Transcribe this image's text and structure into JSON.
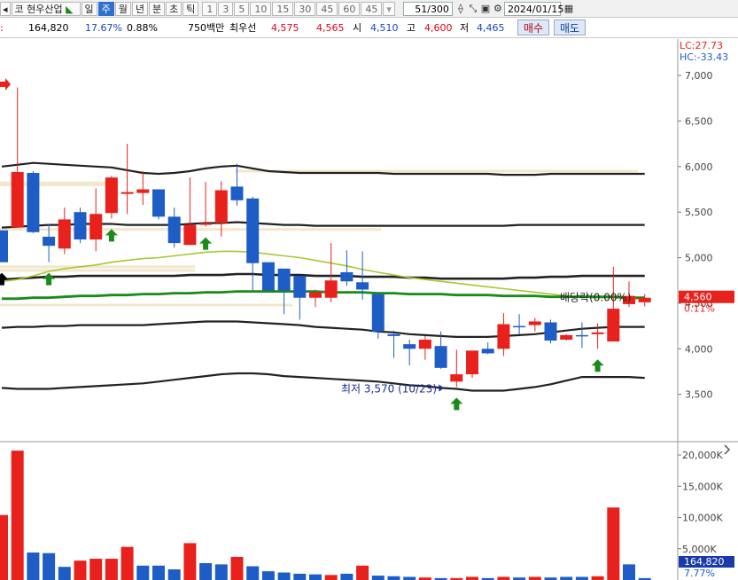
{
  "toolbar": {
    "stock_prefix": "코",
    "stock_name": "현우산업",
    "periods": [
      "일",
      "주",
      "월",
      "년",
      "분",
      "초",
      "틱"
    ],
    "active_period": "주",
    "intervals": [
      "1",
      "3",
      "5",
      "10",
      "15",
      "30",
      "45",
      "60",
      "45"
    ],
    "count_display": "51/300",
    "date": "2024/01/15"
  },
  "quote": {
    "volume": "164,820",
    "turnover_pct": "17.67%",
    "change_pct": "0.88%",
    "trade_amount": "750백만",
    "best_ask_label": "최우선",
    "best_ask": "4,575",
    "best_bid": "4,565",
    "open_label": "시",
    "open": "4,510",
    "high_label": "고",
    "high": "4,600",
    "low_label": "저",
    "low": "4,465",
    "buy_label": "매수",
    "sell_label": "매도"
  },
  "colors": {
    "up": "#e8211c",
    "down": "#1e5dc6",
    "ma_short": "#a8c832",
    "ma_long": "#1a8a1a",
    "band": "#222222",
    "arrow_buy": "#1a8a1a",
    "arrow_special": "#000000"
  },
  "chart_data": [
    {
      "type": "candlestick",
      "title": "",
      "ylim": [
        3000,
        7400
      ],
      "y_ticks": [
        "7,000",
        "6,500",
        "6,000",
        "5,500",
        "5,000",
        "4,500",
        "4,000",
        "3,500"
      ],
      "y_tick_values": [
        7000,
        6500,
        6000,
        5500,
        5000,
        4500,
        4000,
        3500
      ],
      "indicator_top": [
        "LC:27.73",
        "HC:-33.43"
      ],
      "last_price_label": "4,560",
      "last_change_label": "0.11%",
      "last_price_value": 4560,
      "annotations": [
        {
          "text": "최저 3,570 (10/23)",
          "value": 3570
        },
        {
          "text": "배당락(0.00%)"
        }
      ],
      "ohlc": [
        {
          "o": 5300,
          "h": 5300,
          "l": 4950,
          "c": 4950
        },
        {
          "o": 5330,
          "h": 6870,
          "l": 5330,
          "c": 5940
        },
        {
          "o": 5930,
          "h": 5950,
          "l": 5270,
          "c": 5280
        },
        {
          "o": 5230,
          "h": 5370,
          "l": 4950,
          "c": 5130
        },
        {
          "o": 5100,
          "h": 5550,
          "l": 5040,
          "c": 5420
        },
        {
          "o": 5500,
          "h": 5550,
          "l": 5160,
          "c": 5200
        },
        {
          "o": 5200,
          "h": 5760,
          "l": 5070,
          "c": 5480
        },
        {
          "o": 5490,
          "h": 5900,
          "l": 5430,
          "c": 5880
        },
        {
          "o": 5700,
          "h": 6250,
          "l": 5480,
          "c": 5720
        },
        {
          "o": 5710,
          "h": 5950,
          "l": 5580,
          "c": 5750
        },
        {
          "o": 5750,
          "h": 5750,
          "l": 5420,
          "c": 5450
        },
        {
          "o": 5450,
          "h": 5550,
          "l": 5110,
          "c": 5160
        },
        {
          "o": 5140,
          "h": 5880,
          "l": 5140,
          "c": 5360
        },
        {
          "o": 5360,
          "h": 5830,
          "l": 5340,
          "c": 5380
        },
        {
          "o": 5380,
          "h": 5840,
          "l": 5230,
          "c": 5740
        },
        {
          "o": 5780,
          "h": 6030,
          "l": 5570,
          "c": 5630
        },
        {
          "o": 5650,
          "h": 5670,
          "l": 4640,
          "c": 4940
        },
        {
          "o": 4950,
          "h": 4950,
          "l": 4670,
          "c": 4640
        },
        {
          "o": 4880,
          "h": 4880,
          "l": 4380,
          "c": 4640
        },
        {
          "o": 4800,
          "h": 4800,
          "l": 4320,
          "c": 4560
        },
        {
          "o": 4560,
          "h": 4650,
          "l": 4460,
          "c": 4620
        },
        {
          "o": 4560,
          "h": 5160,
          "l": 4510,
          "c": 4750
        },
        {
          "o": 4840,
          "h": 5080,
          "l": 4690,
          "c": 4740
        },
        {
          "o": 4730,
          "h": 5070,
          "l": 4540,
          "c": 4650
        },
        {
          "o": 4600,
          "h": 4600,
          "l": 4110,
          "c": 4190
        },
        {
          "o": 4160,
          "h": 4200,
          "l": 3900,
          "c": 4140
        },
        {
          "o": 4050,
          "h": 4100,
          "l": 3820,
          "c": 4000
        },
        {
          "o": 4000,
          "h": 4140,
          "l": 3880,
          "c": 4100
        },
        {
          "o": 4030,
          "h": 4190,
          "l": 3780,
          "c": 3790
        },
        {
          "o": 3640,
          "h": 3990,
          "l": 3580,
          "c": 3720
        },
        {
          "o": 3720,
          "h": 3960,
          "l": 3680,
          "c": 3980
        },
        {
          "o": 4000,
          "h": 4070,
          "l": 3940,
          "c": 3950
        },
        {
          "o": 4000,
          "h": 4390,
          "l": 3920,
          "c": 4270
        },
        {
          "o": 4250,
          "h": 4380,
          "l": 4160,
          "c": 4240
        },
        {
          "o": 4260,
          "h": 4340,
          "l": 4190,
          "c": 4300
        },
        {
          "o": 4290,
          "h": 4320,
          "l": 4060,
          "c": 4090
        },
        {
          "o": 4100,
          "h": 4160,
          "l": 4090,
          "c": 4150
        },
        {
          "o": 4150,
          "h": 4290,
          "l": 4010,
          "c": 4140
        },
        {
          "o": 4160,
          "h": 4280,
          "l": 4000,
          "c": 4180
        },
        {
          "o": 4080,
          "h": 4900,
          "l": 4080,
          "c": 4440
        },
        {
          "o": 4490,
          "h": 4740,
          "l": 4460,
          "c": 4580
        },
        {
          "o": 4510,
          "h": 4600,
          "l": 4465,
          "c": 4560
        }
      ],
      "bands": {
        "upper2": [
          6000,
          6020,
          6040,
          6030,
          6020,
          6010,
          6000,
          5990,
          5960,
          5930,
          5920,
          5930,
          5950,
          5980,
          6000,
          6010,
          5980,
          5950,
          5940,
          5930,
          5930,
          5930,
          5930,
          5930,
          5930,
          5920,
          5920,
          5920,
          5920,
          5920,
          5920,
          5920,
          5910,
          5910,
          5910,
          5920,
          5920,
          5920,
          5920,
          5920,
          5920,
          5920
        ],
        "upper1": [
          5330,
          5340,
          5350,
          5360,
          5360,
          5370,
          5370,
          5370,
          5360,
          5360,
          5360,
          5360,
          5370,
          5380,
          5380,
          5390,
          5380,
          5370,
          5360,
          5360,
          5350,
          5350,
          5350,
          5350,
          5350,
          5350,
          5350,
          5350,
          5350,
          5350,
          5350,
          5350,
          5350,
          5360,
          5360,
          5360,
          5360,
          5360,
          5360,
          5360,
          5360,
          5360
        ],
        "mid": [
          4760,
          4770,
          4780,
          4790,
          4790,
          4800,
          4800,
          4800,
          4800,
          4800,
          4800,
          4800,
          4810,
          4810,
          4810,
          4820,
          4820,
          4810,
          4810,
          4810,
          4800,
          4800,
          4800,
          4790,
          4790,
          4790,
          4780,
          4780,
          4770,
          4770,
          4770,
          4770,
          4770,
          4780,
          4780,
          4790,
          4790,
          4800,
          4800,
          4800,
          4800,
          4800
        ],
        "lower1": [
          4230,
          4240,
          4240,
          4250,
          4250,
          4260,
          4260,
          4260,
          4260,
          4260,
          4270,
          4280,
          4290,
          4300,
          4300,
          4300,
          4290,
          4280,
          4270,
          4260,
          4240,
          4230,
          4220,
          4210,
          4190,
          4180,
          4160,
          4150,
          4140,
          4130,
          4130,
          4130,
          4140,
          4150,
          4160,
          4180,
          4200,
          4220,
          4230,
          4240,
          4240,
          4240
        ],
        "lower2": [
          3570,
          3560,
          3560,
          3560,
          3570,
          3580,
          3590,
          3600,
          3610,
          3620,
          3640,
          3660,
          3680,
          3700,
          3720,
          3730,
          3730,
          3720,
          3700,
          3690,
          3680,
          3670,
          3660,
          3650,
          3640,
          3620,
          3600,
          3590,
          3570,
          3560,
          3540,
          3540,
          3540,
          3560,
          3580,
          3610,
          3650,
          3690,
          3690,
          3690,
          3690,
          3680
        ]
      },
      "ma_short": [
        4740,
        4760,
        4800,
        4850,
        4880,
        4900,
        4920,
        4950,
        4970,
        4990,
        5000,
        5020,
        5040,
        5060,
        5070,
        5070,
        5060,
        5040,
        5020,
        5000,
        4970,
        4940,
        4910,
        4870,
        4840,
        4810,
        4780,
        4760,
        4740,
        4720,
        4700,
        4680,
        4660,
        4640,
        4620,
        4600,
        4580,
        4570,
        4560,
        4560,
        4550,
        4550
      ],
      "ma_long": [
        4550,
        4550,
        4560,
        4560,
        4570,
        4580,
        4580,
        4590,
        4590,
        4600,
        4600,
        4610,
        4610,
        4620,
        4620,
        4630,
        4630,
        4630,
        4630,
        4630,
        4630,
        4620,
        4620,
        4620,
        4610,
        4610,
        4600,
        4600,
        4600,
        4590,
        4590,
        4590,
        4580,
        4580,
        4580,
        4570,
        4570,
        4570,
        4570,
        4570,
        4560,
        4560
      ],
      "buy_arrows": [
        3,
        7,
        13,
        29,
        38
      ],
      "special_arrows": [
        0
      ]
    },
    {
      "type": "bar",
      "title": "",
      "ylim": [
        0,
        21000
      ],
      "y_ticks": [
        "20,000K",
        "15,000K",
        "10,000K",
        "5,000K"
      ],
      "y_tick_values": [
        20000,
        15000,
        10000,
        5000
      ],
      "last_volume_label": "164,820",
      "last_volume_change": "7.77%",
      "values": [
        10400,
        20700,
        4400,
        4300,
        2100,
        3100,
        3400,
        3400,
        5300,
        2300,
        2300,
        1700,
        5900,
        2700,
        2500,
        3700,
        2200,
        1400,
        1200,
        1000,
        900,
        800,
        1000,
        2300,
        700,
        600,
        500,
        400,
        300,
        300,
        500,
        300,
        500,
        400,
        500,
        400,
        500,
        500,
        600,
        11600,
        2500,
        300
      ],
      "up": [
        true,
        true,
        false,
        false,
        false,
        true,
        true,
        true,
        true,
        false,
        false,
        false,
        true,
        false,
        false,
        true,
        false,
        false,
        false,
        false,
        false,
        true,
        false,
        true,
        false,
        false,
        false,
        true,
        false,
        true,
        true,
        false,
        true,
        false,
        true,
        false,
        false,
        false,
        true,
        true,
        false,
        false
      ]
    }
  ]
}
